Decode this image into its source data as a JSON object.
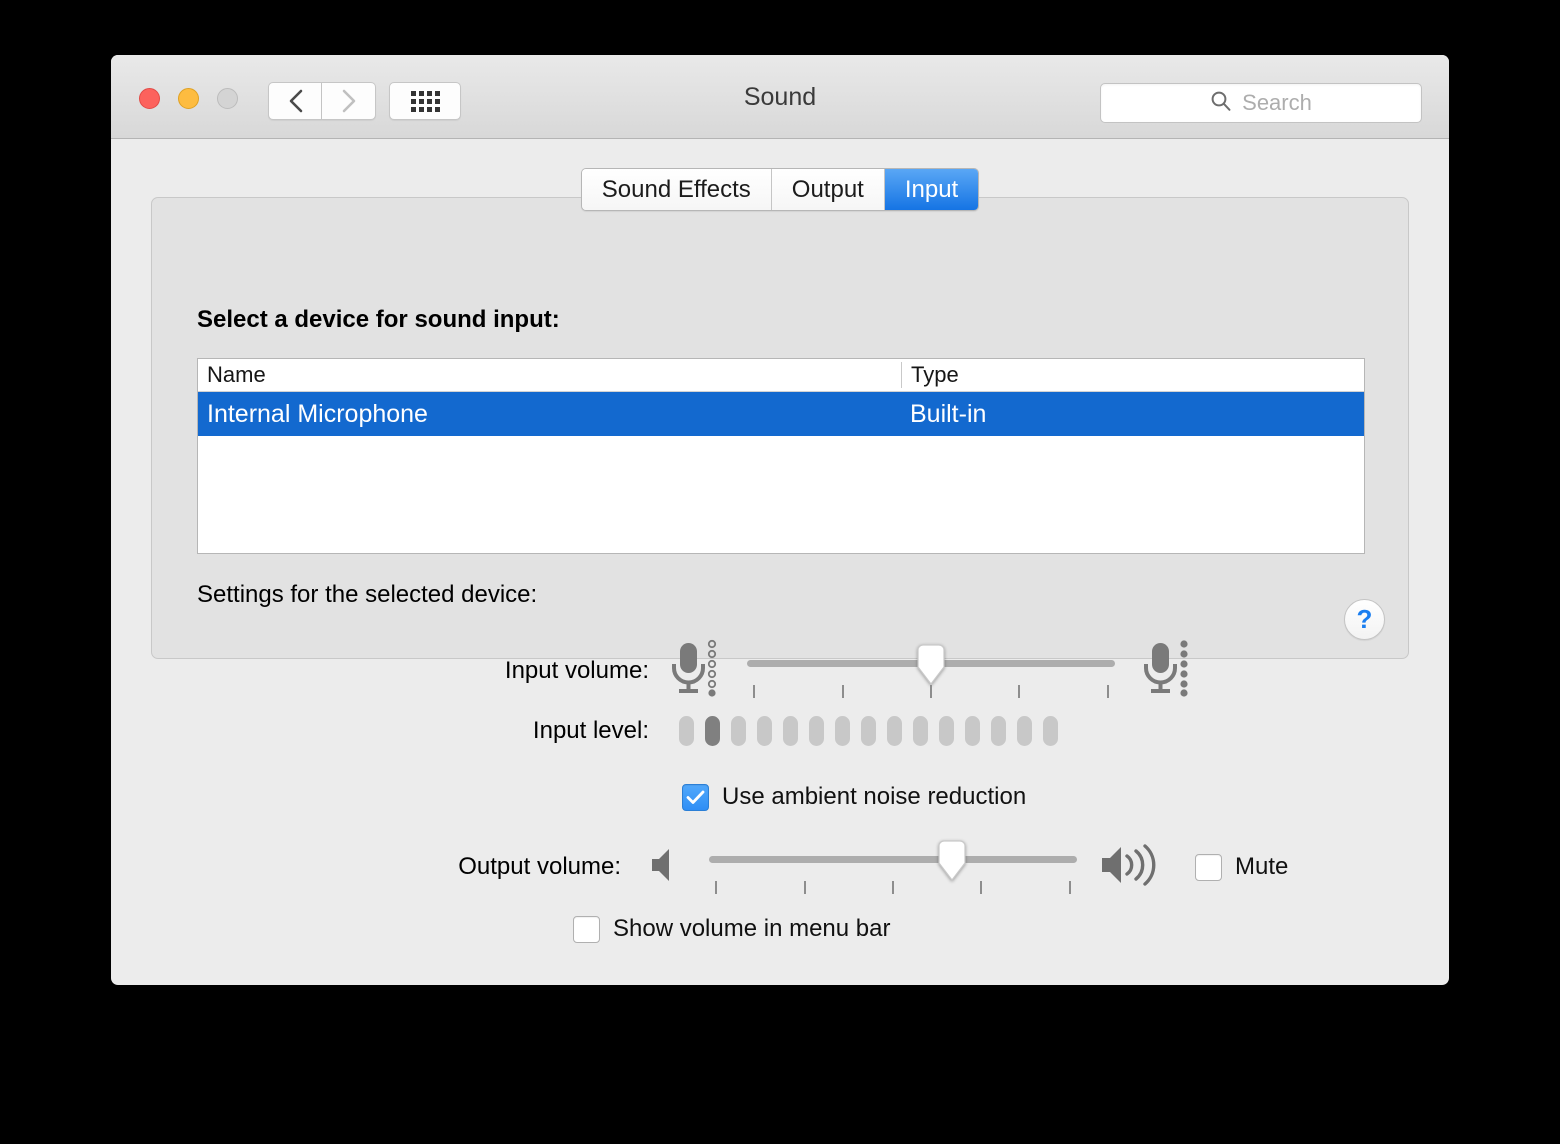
{
  "window": {
    "title": "Sound",
    "traffic_lights": [
      "close-button",
      "minimize-button",
      "zoom-button"
    ],
    "nav": {
      "back": "back-button",
      "forward": "forward-button",
      "grid": "show-all-button"
    },
    "search": {
      "placeholder": "Search",
      "value": "",
      "icon": "search-icon"
    }
  },
  "tabs": [
    {
      "label": "Sound Effects",
      "selected": false
    },
    {
      "label": "Output",
      "selected": false
    },
    {
      "label": "Input",
      "selected": true
    }
  ],
  "panel": {
    "device_header": "Select a device for sound input:",
    "table": {
      "columns": [
        "Name",
        "Type"
      ],
      "rows": [
        {
          "name": "Internal Microphone",
          "type": "Built-in",
          "selected": true
        }
      ]
    },
    "settings_header": "Settings for the selected device:",
    "input_volume": {
      "label": "Input volume:",
      "value_percent": 50,
      "tick_count": 5,
      "icon_low": "microphone-quiet-icon",
      "icon_high": "microphone-loud-icon"
    },
    "input_level": {
      "label": "Input level:",
      "segments_total": 15,
      "segments_active": 2,
      "active_index": 1
    },
    "noise_reduction": {
      "label": "Use ambient noise reduction",
      "checked": true
    },
    "help": {
      "glyph": "?",
      "name": "help-button"
    }
  },
  "footer": {
    "output_volume": {
      "label": "Output volume:",
      "value_percent": 66,
      "tick_count": 5,
      "icon_low": "speaker-mute-icon",
      "icon_high": "speaker-loud-icon"
    },
    "mute": {
      "label": "Mute",
      "checked": false
    },
    "show_in_menu_bar": {
      "label": "Show volume in menu bar",
      "checked": false
    }
  },
  "colors": {
    "accent_blue": "#1369cf",
    "tab_active_blue": "#1574e4",
    "checkbox_blue": "#2f8ef5",
    "help_blue": "#1a7ef0",
    "window_bg": "#ececec",
    "panel_bg": "#e2e2e2"
  }
}
